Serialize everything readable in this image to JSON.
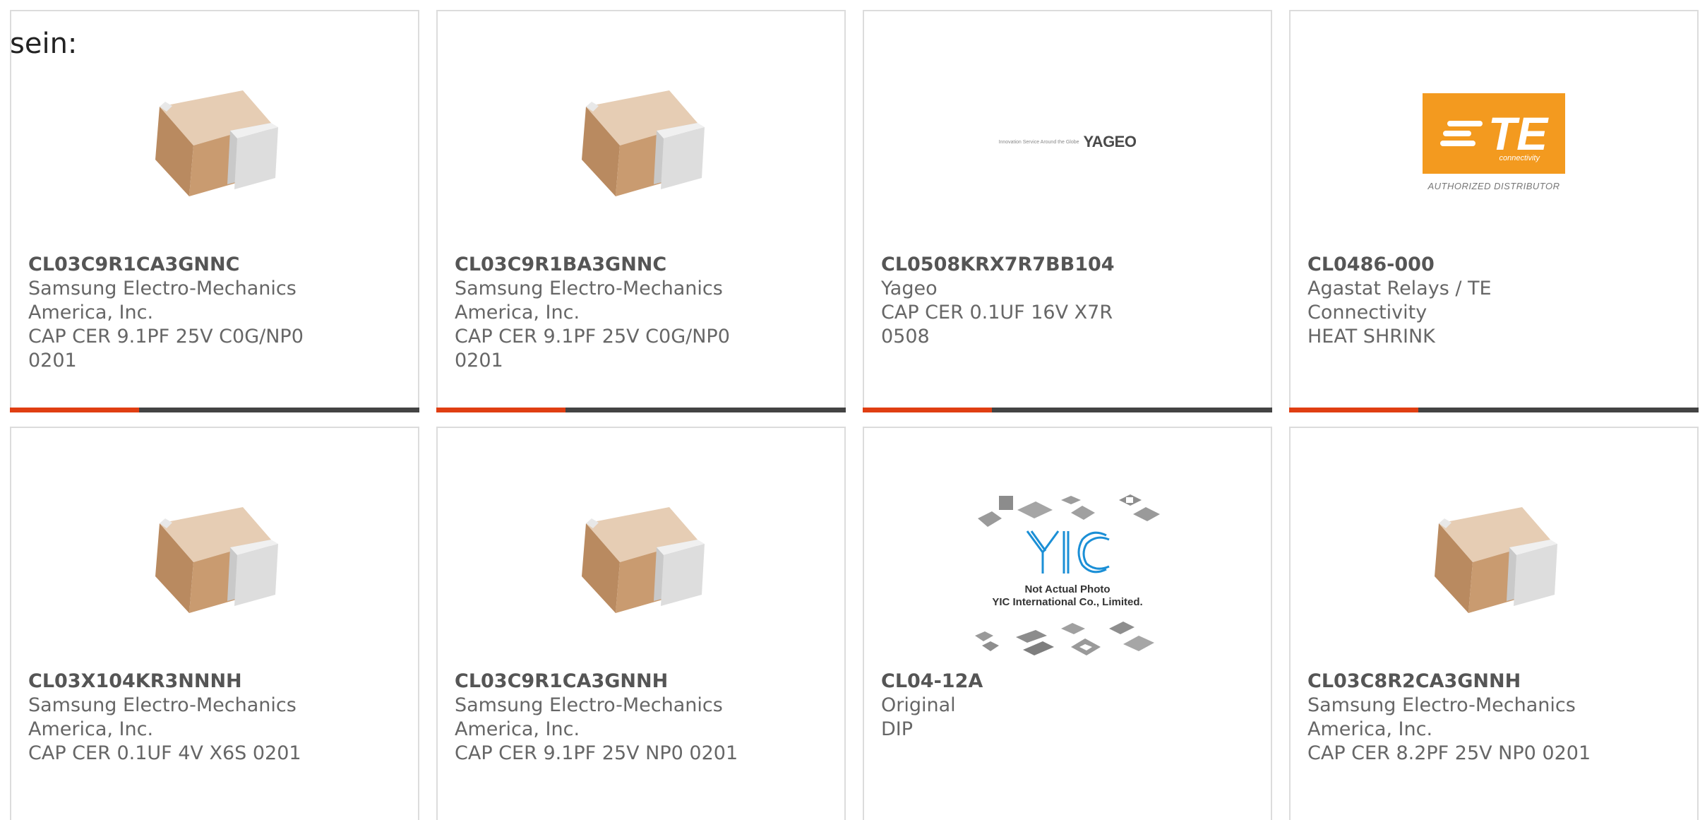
{
  "intro_text": "sein:",
  "colors": {
    "accent": "#e03e12",
    "bar": "#444444",
    "border": "#dcdcdc",
    "text": "#666666",
    "te_orange": "#f39a1f"
  },
  "products": [
    {
      "part_number": "CL03C9R1CA3GNNC",
      "manufacturer": "Samsung Electro-Mechanics America, Inc.",
      "description": "CAP CER 9.1PF 25V C0G/NP0 0201",
      "image": "capacitor-chip-icon"
    },
    {
      "part_number": "CL03C9R1BA3GNNC",
      "manufacturer": "Samsung Electro-Mechanics America, Inc.",
      "description": "CAP CER 9.1PF 25V C0G/NP0 0201",
      "image": "capacitor-chip-icon"
    },
    {
      "part_number": "CL0508KRX7R7BB104",
      "manufacturer": "Yageo",
      "description": "CAP CER 0.1UF 16V X7R 0508",
      "image": "yageo-logo",
      "logo_text": "YAGEO",
      "logo_tagline": "Innovation Service Around the Globe"
    },
    {
      "part_number": "CL0486-000",
      "manufacturer": "Agastat Relays / TE Connectivity",
      "description": "HEAT SHRINK",
      "image": "te-logo",
      "logo_text": "TE",
      "logo_sub": "connectivity",
      "logo_caption": "AUTHORIZED DISTRIBUTOR"
    },
    {
      "part_number": "CL03X104KR3NNNH",
      "manufacturer": "Samsung Electro-Mechanics America, Inc.",
      "description": "CAP CER 0.1UF 4V X6S 0201",
      "image": "capacitor-chip-icon"
    },
    {
      "part_number": "CL03C9R1CA3GNNH",
      "manufacturer": "Samsung Electro-Mechanics America, Inc.",
      "description": "CAP CER 9.1PF 25V NP0 0201",
      "image": "capacitor-chip-icon"
    },
    {
      "part_number": "CL04-12A",
      "manufacturer": "Original",
      "description": "DIP",
      "image": "yic-placeholder",
      "note_line1": "Not Actual Photo",
      "note_line2": "YIC International Co., Limited."
    },
    {
      "part_number": "CL03C8R2CA3GNNH",
      "manufacturer": "Samsung Electro-Mechanics America, Inc.",
      "description": "CAP CER 8.2PF 25V NP0 0201",
      "image": "capacitor-chip-icon"
    }
  ]
}
